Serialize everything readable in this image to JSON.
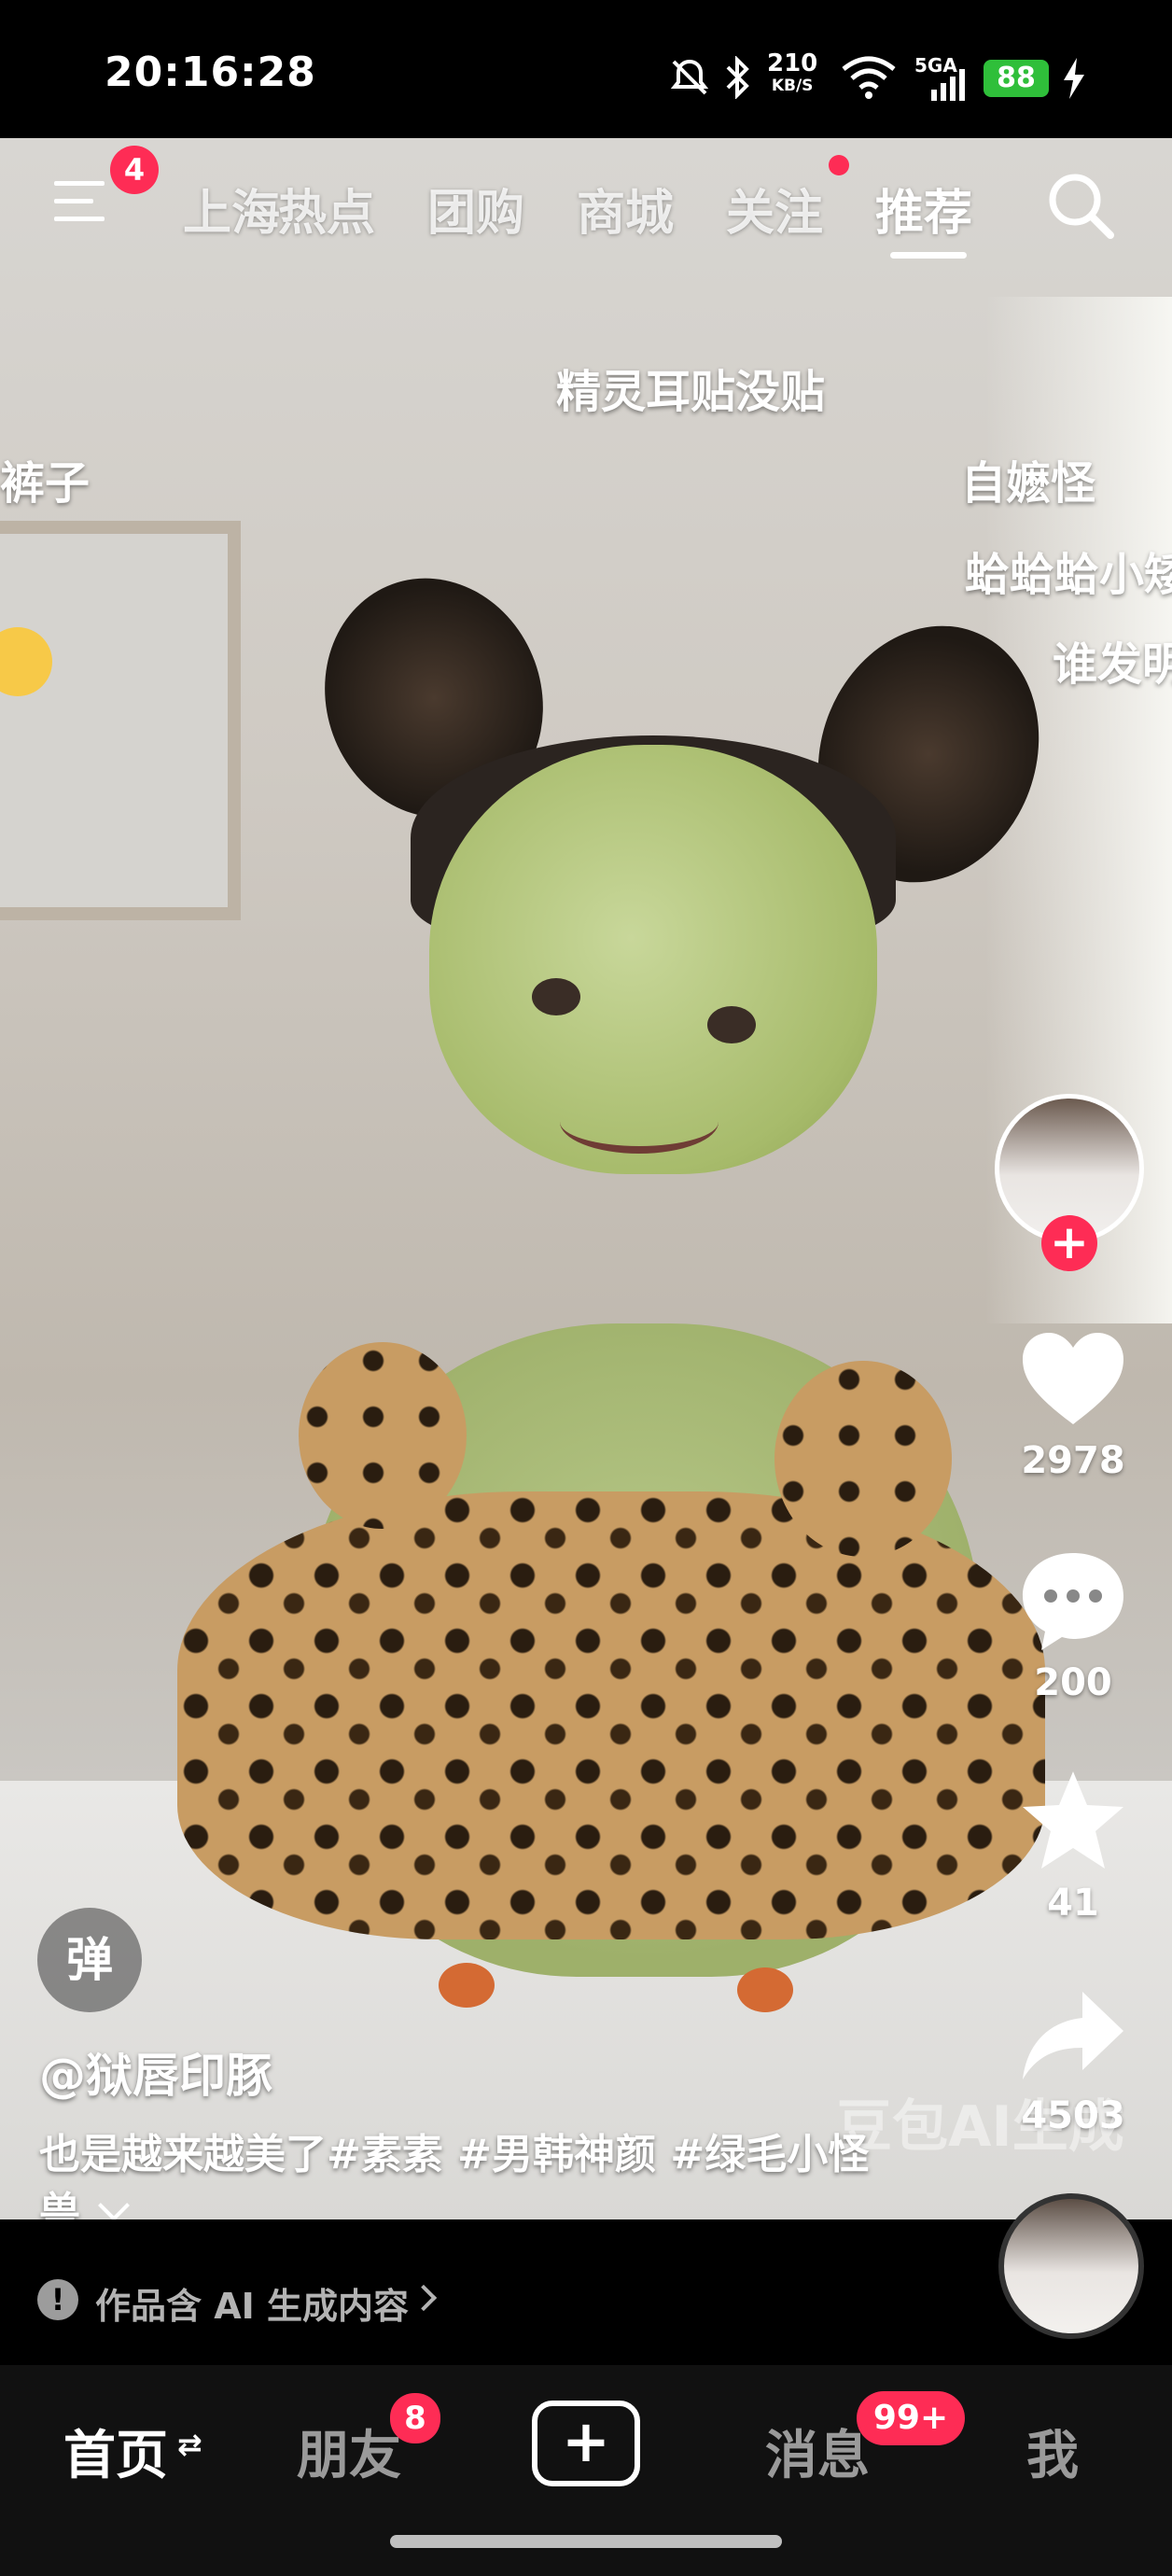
{
  "status_bar": {
    "time": "20:16:28",
    "net_speed_value": "210",
    "net_speed_unit": "KB/S",
    "signal_label": "5GA",
    "battery": "88",
    "icons": [
      "mute-icon",
      "bluetooth-icon",
      "wifi-icon",
      "signal-icon",
      "battery-icon",
      "charging-icon"
    ]
  },
  "top_nav": {
    "menu_badge": "4",
    "tabs": [
      {
        "label": "上海"
      },
      {
        "label": "热点"
      },
      {
        "label": "团购"
      },
      {
        "label": "商城"
      },
      {
        "label": "关注"
      },
      {
        "label": "推荐"
      }
    ],
    "active_tab": "推荐"
  },
  "danmaku": [
    {
      "text": "精灵耳贴没贴"
    },
    {
      "text": "裤子"
    },
    {
      "text": "自嬷怪"
    },
    {
      "text": "蛤蛤蛤小矮"
    },
    {
      "text": "谁发明"
    }
  ],
  "right_rail": {
    "follow_plus": "+",
    "likes": "2978",
    "comments": "200",
    "favorites": "41",
    "shares": "4503"
  },
  "post": {
    "barrage_button": "弹",
    "author": "@狱唇印豚",
    "caption": "也是越来越美了#素素 #男韩神颜 #绿毛小怪兽",
    "watermark": "豆包AI生成"
  },
  "ai_notice": {
    "text": "作品含 AI 生成内容",
    "icon": "!"
  },
  "bottom_tabs": {
    "home": "首页",
    "home_switch": "⇄",
    "friends": "朋友",
    "friends_badge": "8",
    "create": "+",
    "messages": "消息",
    "messages_badge": "99+",
    "me": "我"
  },
  "colors": {
    "accent": "#fe2c55",
    "battery": "#2fbf3a",
    "tabbar_bg": "#111111"
  }
}
